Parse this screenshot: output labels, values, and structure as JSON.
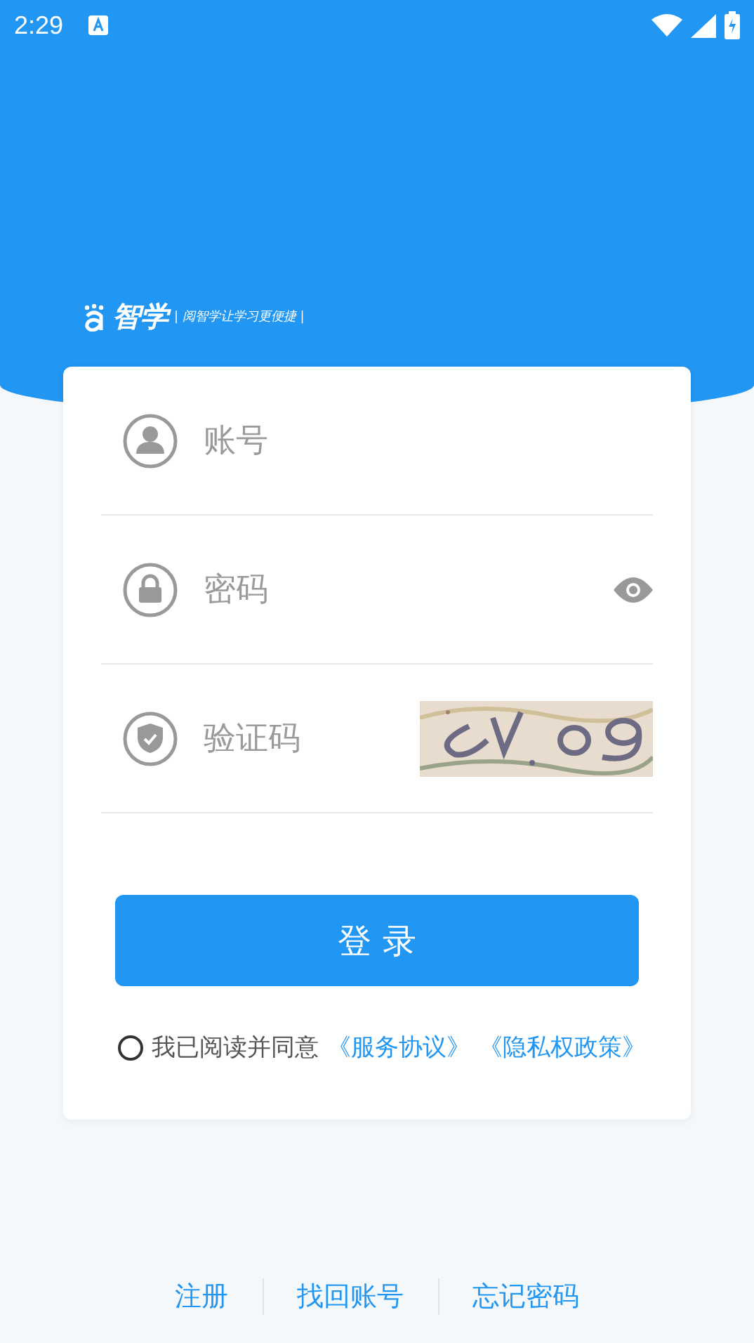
{
  "status_bar": {
    "time": "2:29"
  },
  "logo": {
    "name": "智学",
    "slogan": "| 阅智学让学习更便捷 |"
  },
  "fields": [
    {
      "kind": "account",
      "placeholder": "账号"
    },
    {
      "kind": "password",
      "placeholder": "密码"
    },
    {
      "kind": "captcha",
      "placeholder": "验证码"
    }
  ],
  "login_button": "登 录",
  "agreement": {
    "checked": false,
    "text": "我已阅读并同意",
    "links": [
      "《服务协议》",
      "《隐私权政策》"
    ]
  },
  "footer_links": [
    "注册",
    "找回账号",
    "忘记密码"
  ]
}
